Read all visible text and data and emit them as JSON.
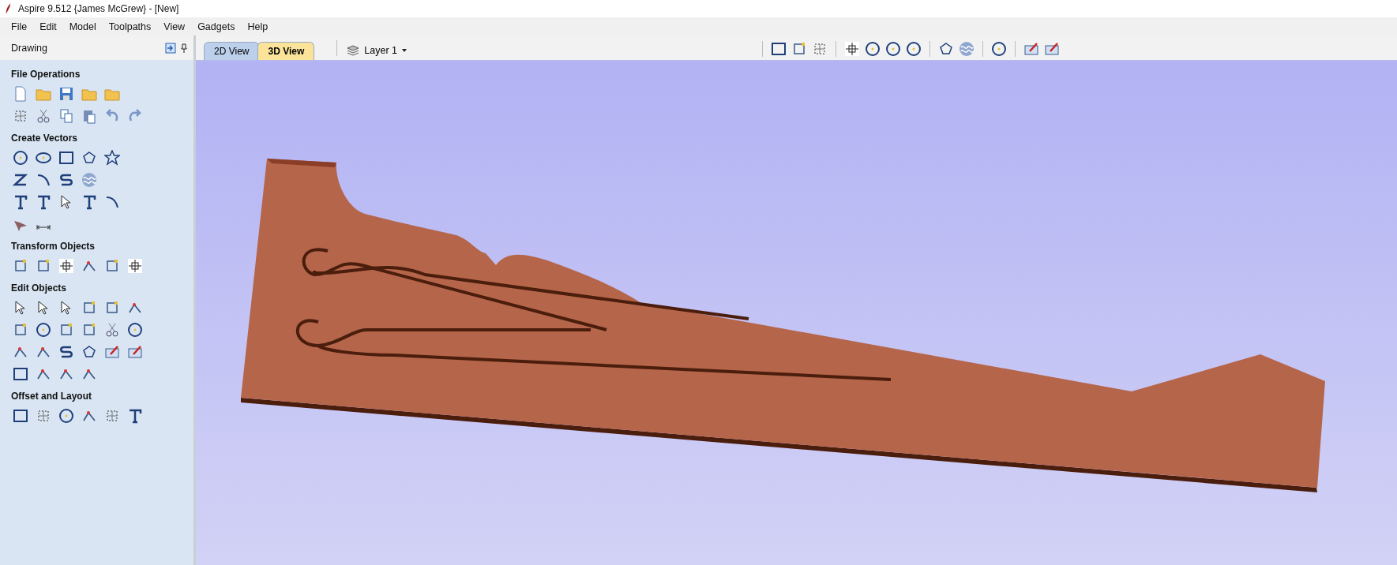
{
  "window": {
    "title": "Aspire 9.512 {James McGrew} - [New]"
  },
  "menu": [
    "File",
    "Edit",
    "Model",
    "Toolpaths",
    "View",
    "Gadgets",
    "Help"
  ],
  "panel": {
    "title": "Drawing",
    "sections": [
      {
        "title": "File Operations"
      },
      {
        "title": "Create Vectors"
      },
      {
        "title": "Transform Objects"
      },
      {
        "title": "Edit Objects"
      },
      {
        "title": "Offset and Layout"
      }
    ]
  },
  "tabs": [
    {
      "label": "2D View",
      "selected": false
    },
    {
      "label": "3D View",
      "selected": true
    }
  ],
  "layer": {
    "label": "Layer 1"
  }
}
